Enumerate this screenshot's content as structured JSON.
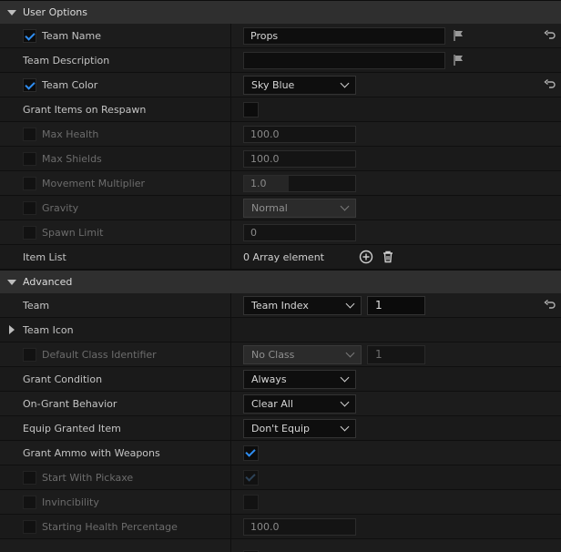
{
  "sections": {
    "user_options": "User Options",
    "advanced": "Advanced"
  },
  "user_options": {
    "team_name": {
      "label": "Team Name",
      "checked": true,
      "value": "Props"
    },
    "team_description": {
      "label": "Team Description",
      "value": ""
    },
    "team_color": {
      "label": "Team Color",
      "checked": true,
      "value": "Sky Blue"
    },
    "grant_items_on_respawn": {
      "label": "Grant Items on Respawn",
      "checked": false
    },
    "max_health": {
      "label": "Max Health",
      "value": "100.0"
    },
    "max_shields": {
      "label": "Max Shields",
      "value": "100.0"
    },
    "movement_multiplier": {
      "label": "Movement Multiplier",
      "value": "1.0",
      "fill_fraction": 0.4
    },
    "gravity": {
      "label": "Gravity",
      "value": "Normal"
    },
    "spawn_limit": {
      "label": "Spawn Limit",
      "value": "0"
    },
    "item_list": {
      "label": "Item List",
      "value": "0 Array element"
    }
  },
  "advanced": {
    "team": {
      "label": "Team",
      "value": "Team Index",
      "number": "1"
    },
    "team_icon": {
      "label": "Team Icon"
    },
    "default_class_identifier": {
      "label": "Default Class Identifier",
      "value": "No Class",
      "number": "1"
    },
    "grant_condition": {
      "label": "Grant Condition",
      "value": "Always"
    },
    "on_grant_behavior": {
      "label": "On-Grant Behavior",
      "value": "Clear All"
    },
    "equip_granted_item": {
      "label": "Equip Granted Item",
      "value": "Don't Equip"
    },
    "grant_ammo_with_weapons": {
      "label": "Grant Ammo with Weapons",
      "checked": true
    },
    "start_with_pickaxe": {
      "label": "Start With Pickaxe",
      "checked": true
    },
    "invincibility": {
      "label": "Invincibility",
      "checked": false
    },
    "starting_health_percentage": {
      "label": "Starting Health Percentage",
      "value": "100.0"
    }
  },
  "colors": {
    "accent": "#2f8df0",
    "background": "#151515",
    "section_header": "#2f2f2f"
  },
  "icons": {
    "section_collapse": "chevron-down-icon",
    "flag": "flag-icon",
    "reset": "reset-arrow-icon",
    "add": "add-circle-icon",
    "delete": "trash-icon"
  }
}
